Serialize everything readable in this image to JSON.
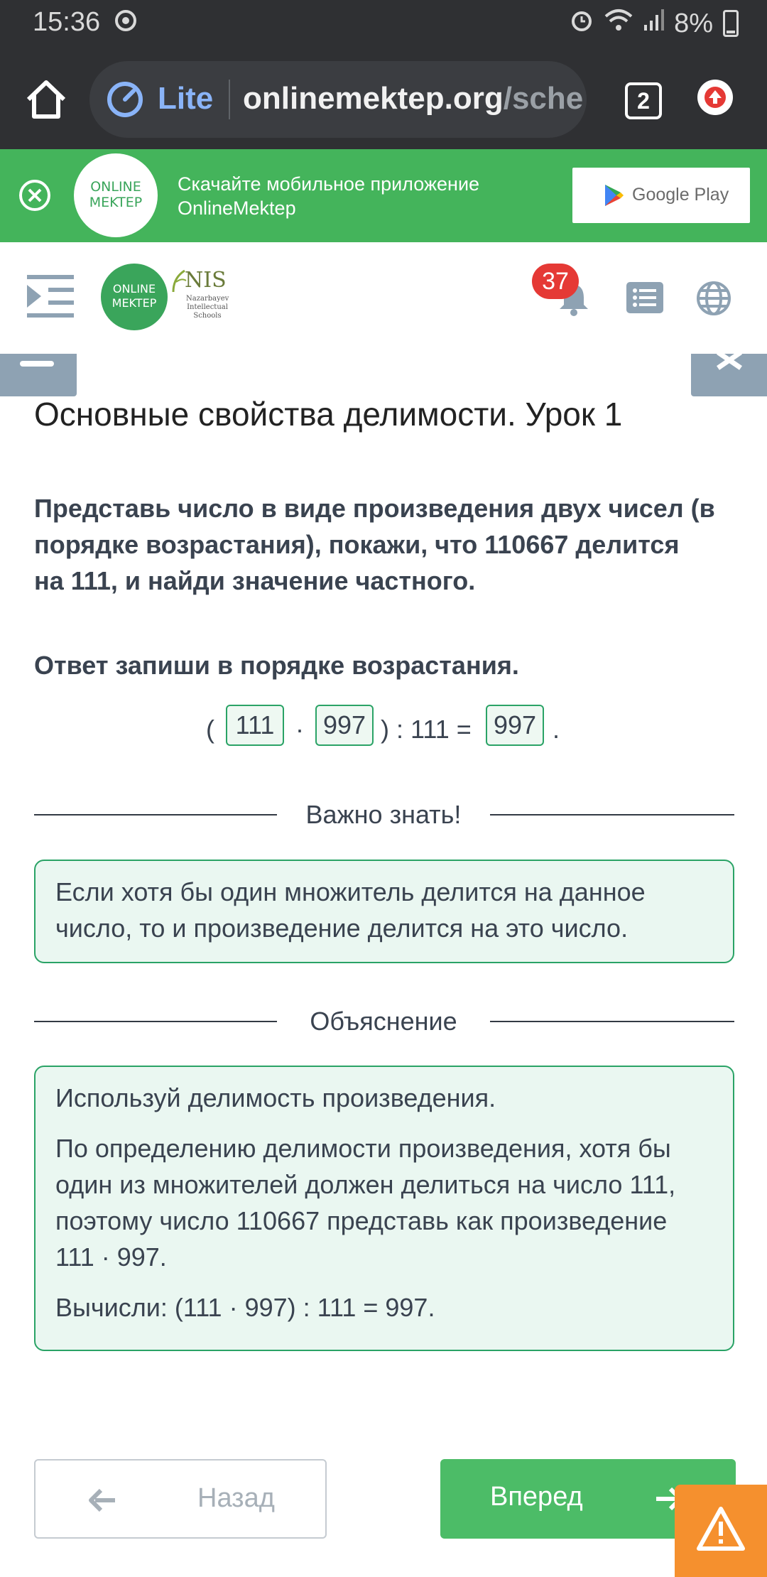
{
  "status_bar": {
    "time": "15:36",
    "battery": "8%",
    "icons": [
      "sync-icon",
      "alarm-icon",
      "wifi-icon",
      "signal-icon",
      "battery-icon"
    ]
  },
  "browser": {
    "lite_label": "Lite",
    "url_domain": "onlinemektep.org",
    "url_tail": "/sche",
    "tab_count": "2"
  },
  "promo": {
    "logo_line1": "ONLINE",
    "logo_line2": "MEKTEP",
    "text_line1": "Скачайте мобильное приложение",
    "text_line2": "OnlineMektep",
    "store_button": "Google Play"
  },
  "header": {
    "logo_line1": "ONLINE",
    "logo_line2": "MEKTEP",
    "nis_title": "NIS",
    "nis_subtitle": "Nazarbayev Intellectual Schools",
    "notification_count": "37"
  },
  "lesson": {
    "title": "Основные свойства делимости. Урок 1",
    "question": "Представь число в виде произведения двух чисел (в порядке возрастания), покажи, что 110667 делится на 111, и найди значение частного.",
    "instruction": "Ответ запиши в порядке возрастания.",
    "equation": {
      "open_paren": "(",
      "factor1": "111",
      "dot": "·",
      "factor2": "997",
      "middle": ") : 111 =",
      "result": "997",
      "end": "."
    }
  },
  "important": {
    "heading": "Важно знать!",
    "text": "Если хотя бы один множитель делится на данное число, то и произведение делится на это число."
  },
  "explanation": {
    "heading": "Объяснение",
    "p1": "Используй делимость произведения.",
    "p2": "По определению делимости произведения, хотя бы один из множителей должен делиться на число 111, поэтому число 110667 представь как произведение 111 · 997.",
    "p3": "Вычисли: (111 · 997) : 111 = 997."
  },
  "nav": {
    "back_label": "Назад",
    "next_label": "Вперед"
  },
  "colors": {
    "accent_green": "#44b45b",
    "answer_border": "#2aa366",
    "warning_orange": "#f5902e",
    "badge_red": "#e53935"
  }
}
